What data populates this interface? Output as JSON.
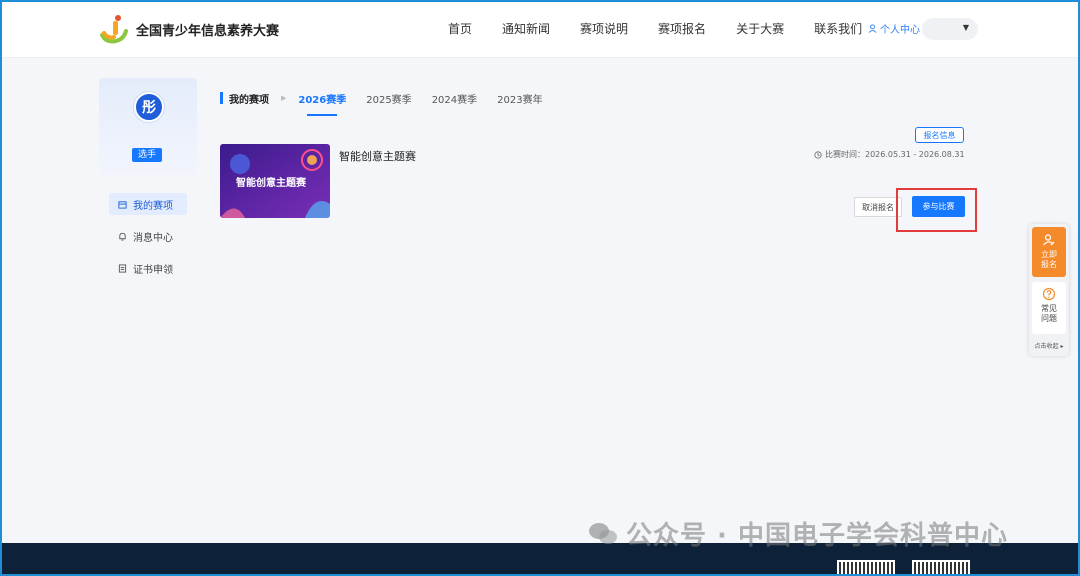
{
  "brand": {
    "title": "全国青少年信息素养大赛"
  },
  "nav": {
    "items": [
      "首页",
      "通知新闻",
      "赛项说明",
      "赛项报名",
      "关于大赛",
      "联系我们"
    ],
    "user_center": "个人中心"
  },
  "profile": {
    "avatar_char": "彤",
    "role": "选手"
  },
  "sidebar": {
    "items": [
      {
        "label": "我的赛项",
        "icon": "box-icon"
      },
      {
        "label": "消息中心",
        "icon": "bell-icon"
      },
      {
        "label": "证书申领",
        "icon": "certificate-icon"
      }
    ]
  },
  "tabs": {
    "title": "我的赛项",
    "seasons": [
      "2026赛季",
      "2025赛季",
      "2024赛季",
      "2023赛年"
    ],
    "active": "2026赛季"
  },
  "competition": {
    "name": "智能创意主题赛",
    "image_text": "智能创意主题赛",
    "signup_info": "报名信息",
    "time_label": "比赛时间：2026.05.31 - 2026.08.31",
    "cancel": "取消报名",
    "join": "参与比赛"
  },
  "float": {
    "signup": "立即报名",
    "faq": "常见问题",
    "collapse": "点击收起"
  },
  "watermark": "公众号 · 中国电子学会科普中心",
  "colors": {
    "primary": "#1677ff",
    "highlight": "#e23b3b",
    "float_accent": "#f58a2a",
    "footer": "#0d2238"
  }
}
